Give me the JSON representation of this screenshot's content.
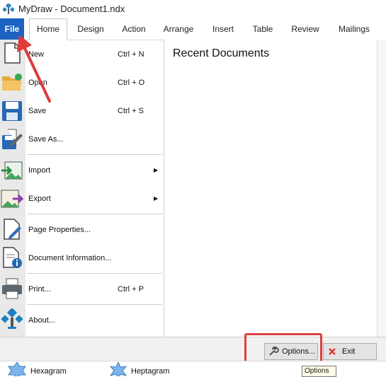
{
  "window": {
    "title": "MyDraw - Document1.ndx",
    "icon": "mydraw-logo-icon"
  },
  "ribbon": {
    "tabs": [
      {
        "label": "File"
      },
      {
        "label": "Home"
      },
      {
        "label": "Design"
      },
      {
        "label": "Action"
      },
      {
        "label": "Arrange"
      },
      {
        "label": "Insert"
      },
      {
        "label": "Table"
      },
      {
        "label": "Review"
      },
      {
        "label": "Mailings"
      }
    ]
  },
  "file_menu": {
    "items": [
      {
        "label": "New",
        "shortcut": "Ctrl + N",
        "icon": "new-document-icon"
      },
      {
        "label": "Open",
        "shortcut": "Ctrl + O",
        "icon": "open-folder-icon"
      },
      {
        "label": "Save",
        "shortcut": "Ctrl + S",
        "icon": "save-floppy-icon"
      },
      {
        "label": "Save As...",
        "shortcut": "",
        "icon": "save-as-icon"
      },
      {
        "label": "Import",
        "shortcut": "",
        "icon": "import-icon",
        "submenu": true
      },
      {
        "label": "Export",
        "shortcut": "",
        "icon": "export-icon",
        "submenu": true
      },
      {
        "label": "Page Properties...",
        "shortcut": "",
        "icon": "page-properties-icon"
      },
      {
        "label": "Document Information...",
        "shortcut": "",
        "icon": "document-info-icon"
      },
      {
        "label": "Print...",
        "shortcut": "Ctrl + P",
        "icon": "printer-icon"
      },
      {
        "label": "About...",
        "shortcut": "",
        "icon": "about-icon"
      }
    ]
  },
  "recent": {
    "title": "Recent Documents"
  },
  "footer": {
    "options_label": "Options...",
    "exit_label": "Exit"
  },
  "tooltip": {
    "text": "Options"
  },
  "shapes": [
    {
      "label": "Hexagram"
    },
    {
      "label": "Heptagram"
    }
  ],
  "colors": {
    "file_tab": "#1c63c2",
    "highlight": "#d94040",
    "accent_blue": "#1f7fc4"
  }
}
